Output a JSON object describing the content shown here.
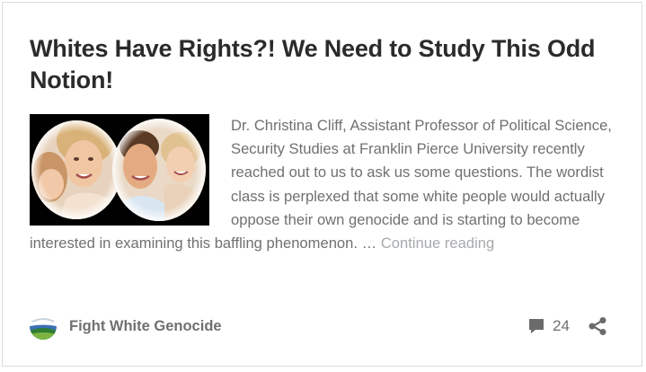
{
  "post": {
    "title": "Whites Have Rights?! We Need to Study This Odd Notion!",
    "excerpt": "Dr. Christina Cliff, Assistant Professor of Political Science, Security Studies at Franklin Pierce University recently reached out to us to ask us some questions. The wordist class is perplexed that some white people would actually oppose their own genocide and is starting to become interested in examining this baffling phenomenon. …",
    "continue_label": "Continue reading",
    "thumbnail_alt": "Family photo"
  },
  "footer": {
    "author": "Fight White Genocide",
    "comment_count": "24"
  },
  "icons": {
    "avatar": "site-logo-icon",
    "comments": "comment-bubble-icon",
    "share": "share-icon"
  },
  "colors": {
    "title": "#2b2b2b",
    "text": "#707070",
    "muted_link": "#a7aaad",
    "border": "#dcdcde"
  }
}
